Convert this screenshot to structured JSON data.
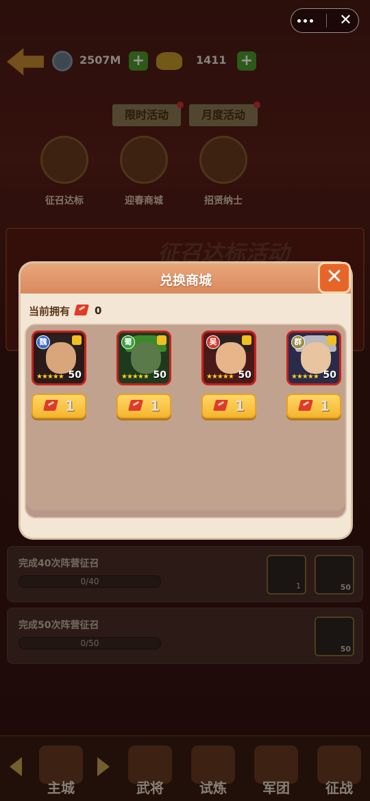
{
  "top": {
    "coins": "2507M",
    "gold": "1411"
  },
  "tabs": [
    {
      "label": "限时活动"
    },
    {
      "label": "月度活动"
    }
  ],
  "activities": [
    {
      "label": "征召达标"
    },
    {
      "label": "迎春商城"
    },
    {
      "label": "招贤纳士"
    }
  ],
  "banner": {
    "title": "征召达标活动"
  },
  "tasks": [
    {
      "title": "完成40次阵营征召",
      "progress": "0/40",
      "rewards": [
        {
          "level": "",
          "count": "1"
        },
        {
          "level": "50",
          "count": ""
        }
      ]
    },
    {
      "title": "完成50次阵营征召",
      "progress": "0/50",
      "rewards": [
        {
          "level": "50",
          "count": ""
        }
      ]
    }
  ],
  "nav": [
    {
      "label": "主城"
    },
    {
      "label": "武将"
    },
    {
      "label": "试炼"
    },
    {
      "label": "军团"
    },
    {
      "label": "征战"
    }
  ],
  "modal": {
    "title": "兑换商城",
    "owned_label": "当前拥有",
    "owned_count": "0",
    "heroes": [
      {
        "faction": "魏",
        "faction_color": "#3a6ad0",
        "level": "50",
        "stars": "★★★★★",
        "cost": "1",
        "icon": "hero-wei-portrait"
      },
      {
        "faction": "蜀",
        "faction_color": "#3aa040",
        "level": "50",
        "stars": "★★★★★",
        "cost": "1",
        "icon": "hero-shu-portrait"
      },
      {
        "faction": "吴",
        "faction_color": "#d03a2a",
        "level": "50",
        "stars": "★★★★★",
        "cost": "1",
        "icon": "hero-wu-portrait"
      },
      {
        "faction": "群",
        "faction_color": "#9a8a40",
        "level": "50",
        "stars": "★★★★★",
        "cost": "1",
        "icon": "hero-qun-portrait"
      }
    ]
  }
}
